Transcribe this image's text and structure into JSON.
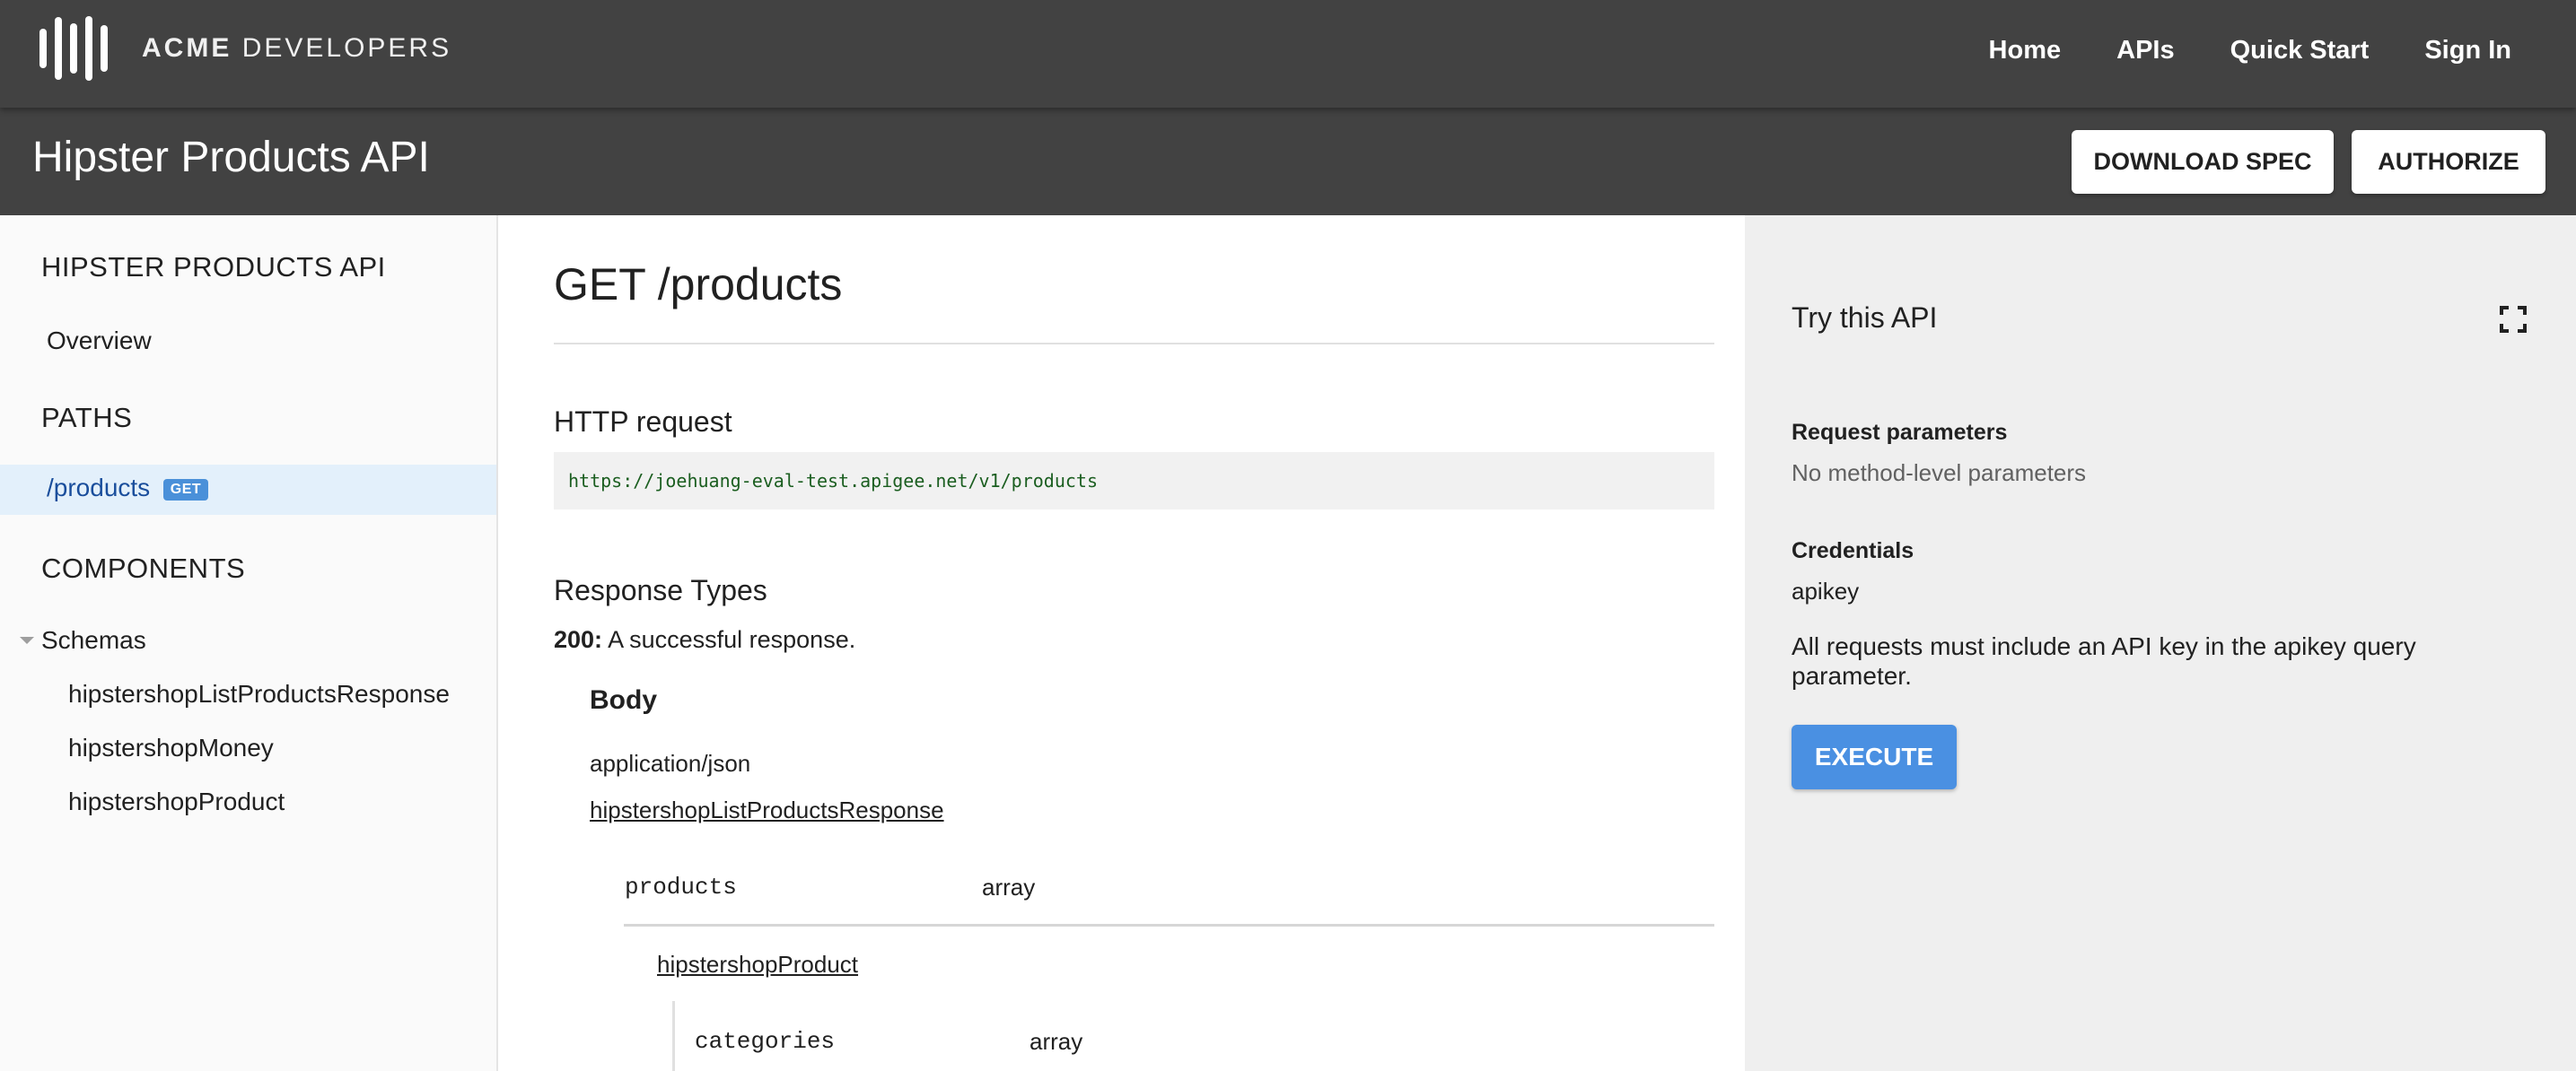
{
  "header": {
    "brand_strong": "ACME",
    "brand_rest": "DEVELOPERS",
    "nav": [
      "Home",
      "APIs",
      "Quick Start",
      "Sign In"
    ]
  },
  "titlebar": {
    "title": "Hipster Products API",
    "download_label": "DOWNLOAD SPEC",
    "authorize_label": "AUTHORIZE"
  },
  "sidebar": {
    "api_heading": "HIPSTER PRODUCTS API",
    "overview": "Overview",
    "paths_heading": "PATHS",
    "active_path": "/products",
    "active_method": "GET",
    "components_heading": "COMPONENTS",
    "schemas_label": "Schemas",
    "schemas": [
      "hipstershopListProductsResponse",
      "hipstershopMoney",
      "hipstershopProduct"
    ]
  },
  "main": {
    "endpoint": "GET /products",
    "http_request_heading": "HTTP request",
    "url": "https://joehuang-eval-test.apigee.net/v1/products",
    "response_types_heading": "Response Types",
    "status_code": "200:",
    "status_desc": "A successful response.",
    "body_heading": "Body",
    "mime": "application/json",
    "schema_link": "hipstershopListProductsResponse",
    "fields": [
      {
        "name": "products",
        "type": "array"
      },
      {
        "name": "categories",
        "type": "array"
      }
    ],
    "nested_schema": "hipstershopProduct"
  },
  "try_panel": {
    "title": "Try this API",
    "req_params_label": "Request parameters",
    "req_params_value": "No method-level parameters",
    "credentials_label": "Credentials",
    "credentials_value": "apikey",
    "description": "All requests must include an API key in the apikey query parameter.",
    "execute_label": "EXECUTE"
  }
}
